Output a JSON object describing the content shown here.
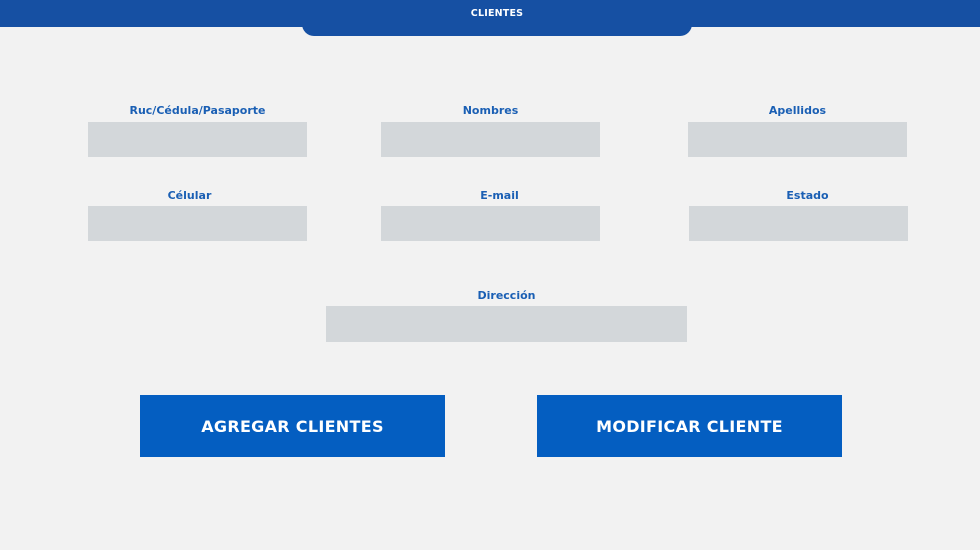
{
  "header": {
    "tab_title": "CLIENTES"
  },
  "form": {
    "fields": {
      "ruc": {
        "label": "Ruc/Cédula/Pasaporte",
        "value": ""
      },
      "nombres": {
        "label": "Nombres",
        "value": ""
      },
      "apellidos": {
        "label": "Apellidos",
        "value": ""
      },
      "celular": {
        "label": "Célular",
        "value": ""
      },
      "email": {
        "label": "E-mail",
        "value": ""
      },
      "estado": {
        "label": "Estado",
        "value": ""
      },
      "direccion": {
        "label": "Dirección",
        "value": ""
      }
    }
  },
  "actions": {
    "add_label": "AGREGAR CLIENTES",
    "modify_label": "MODIFICAR CLIENTE"
  },
  "colors": {
    "header_bg": "#1650a3",
    "label_text": "#1a5fb4",
    "input_bg": "#d3d7da",
    "button_bg": "#045ec1",
    "page_bg": "#f2f2f2"
  }
}
